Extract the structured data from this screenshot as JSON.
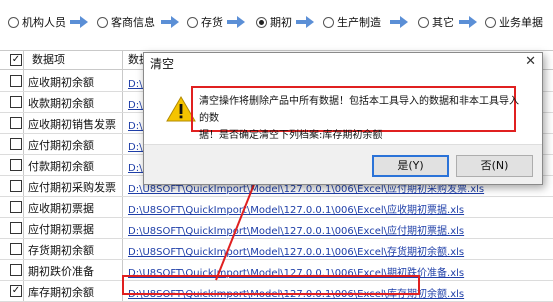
{
  "steps": [
    {
      "label": "机构人员",
      "selected": false
    },
    {
      "label": "客商信息",
      "selected": false
    },
    {
      "label": "存货",
      "selected": false
    },
    {
      "label": "期初",
      "selected": true
    },
    {
      "label": "生产制造",
      "selected": false
    },
    {
      "label": "其它",
      "selected": false
    },
    {
      "label": "业务单据",
      "selected": false
    }
  ],
  "grid": {
    "header": {
      "col1": "数据项",
      "col2": "数据"
    },
    "rows": [
      {
        "checked": false,
        "name": "应收期初余额",
        "path": "D:\\U8SOFT\\QuickImport\\Model\\127.0.0.1\\006\\Excel\\应收期初余额.xls"
      },
      {
        "checked": false,
        "name": "收款期初余额",
        "path": "D:\\U8SOFT\\QuickImport\\Model\\127.0.0.1\\006\\Excel\\收款期初余额.xls"
      },
      {
        "checked": false,
        "name": "应收期初销售发票",
        "path": "D:\\U8SOFT\\QuickImport\\Model\\127.0.0.1\\006\\Excel\\应收期初销售发票.xls"
      },
      {
        "checked": false,
        "name": "应付期初余额",
        "path": "D:\\U8SOFT\\QuickImport\\Model\\127.0.0.1\\006\\Excel\\应付期初余额.xls"
      },
      {
        "checked": false,
        "name": "付款期初余额",
        "path": "D:\\U8SOFT\\QuickImport\\Model\\127.0.0.1\\006\\Excel\\付款期初余额.xls"
      },
      {
        "checked": false,
        "name": "应付期初采购发票",
        "path": "D:\\U8SOFT\\QuickImport\\Model\\127.0.0.1\\006\\Excel\\应付期初采购发票.xls"
      },
      {
        "checked": false,
        "name": "应收期初票据",
        "path": "D:\\U8SOFT\\QuickImport\\Model\\127.0.0.1\\006\\Excel\\应收期初票据.xls"
      },
      {
        "checked": false,
        "name": "应付期初票据",
        "path": "D:\\U8SOFT\\QuickImport\\Model\\127.0.0.1\\006\\Excel\\应付期初票据.xls"
      },
      {
        "checked": false,
        "name": "存货期初余额",
        "path": "D:\\U8SOFT\\QuickImport\\Model\\127.0.0.1\\006\\Excel\\存货期初余额.xls"
      },
      {
        "checked": false,
        "name": "期初跌价准备",
        "path": "D:\\U8SOFT\\QuickImport\\Model\\127.0.0.1\\006\\Excel\\期初跌价准备.xls"
      },
      {
        "checked": true,
        "name": "库存期初余额",
        "path": "D:\\U8SOFT\\QuickImport\\Model\\127.0.0.1\\006\\Excel\\库存期初余额.xls"
      }
    ]
  },
  "dialog": {
    "title": "清空",
    "close_glyph": "✕",
    "message_line1": "清空操作将删除产品中所有数据！包括本工具导入的数据和非本工具导入的数",
    "message_line2": "据！是否确定清空下列档案:库存期初余额",
    "yes_label": "是(Y)",
    "no_label": "否(N)"
  },
  "colors": {
    "annotation_red": "#e02020",
    "step_arrow_blue": "#5b8fd6",
    "link_blue": "#1f3fa8"
  },
  "icons": {
    "step_arrow": "arrow-right-icon",
    "warning": "warning-icon",
    "check": "✓"
  }
}
